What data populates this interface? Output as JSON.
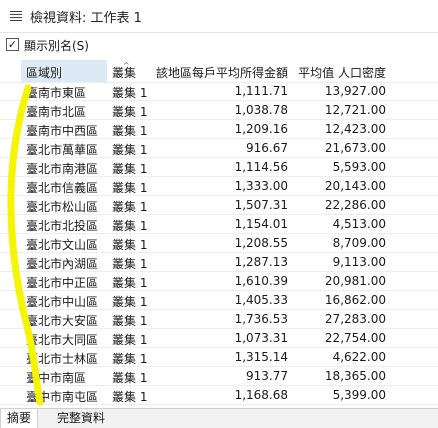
{
  "window": {
    "title": "檢視資料: 工作表 1"
  },
  "toolbar": {
    "alias_checked": true,
    "alias_label": "顯示別名(S)",
    "check_glyph": "✓"
  },
  "table": {
    "headers": [
      "區域別",
      "叢集",
      "該地區每戶平均所得金額",
      "平均值 人口密度"
    ],
    "sort_glyph": "^",
    "rows": [
      [
        "臺南市東區",
        "叢集 1",
        "1,111.71",
        "13,927.00"
      ],
      [
        "臺南市北區",
        "叢集 1",
        "1,038.78",
        "12,721.00"
      ],
      [
        "臺南市中西區",
        "叢集 1",
        "1,209.16",
        "12,423.00"
      ],
      [
        "臺北市萬華區",
        "叢集 1",
        "916.67",
        "21,673.00"
      ],
      [
        "臺北市南港區",
        "叢集 1",
        "1,114.56",
        "5,593.00"
      ],
      [
        "臺北市信義區",
        "叢集 1",
        "1,333.00",
        "20,143.00"
      ],
      [
        "臺北市松山區",
        "叢集 1",
        "1,507.31",
        "22,286.00"
      ],
      [
        "臺北市北投區",
        "叢集 1",
        "1,154.01",
        "4,513.00"
      ],
      [
        "臺北市文山區",
        "叢集 1",
        "1,208.55",
        "8,709.00"
      ],
      [
        "臺北市內湖區",
        "叢集 1",
        "1,287.13",
        "9,113.00"
      ],
      [
        "臺北市中正區",
        "叢集 1",
        "1,610.39",
        "20,981.00"
      ],
      [
        "臺北市中山區",
        "叢集 1",
        "1,405.33",
        "16,862.00"
      ],
      [
        "臺北市大安區",
        "叢集 1",
        "1,736.53",
        "27,283.00"
      ],
      [
        "臺北市大同區",
        "叢集 1",
        "1,073.31",
        "22,754.00"
      ],
      [
        "臺北市士林區",
        "叢集 1",
        "1,315.14",
        "4,622.00"
      ],
      [
        "臺中市南區",
        "叢集 1",
        "913.77",
        "18,365.00"
      ],
      [
        "臺中市南屯區",
        "叢集 1",
        "1,168.68",
        "5,399.00"
      ]
    ]
  },
  "tabs": [
    {
      "label": "摘要",
      "active": true
    },
    {
      "label": "完整資料",
      "active": false
    }
  ],
  "colors": {
    "highlight": "#f5f500",
    "header_selected": "#dde9f5"
  },
  "icons": {
    "title": "list-icon",
    "checkbox": "checkbox-checked-icon"
  }
}
